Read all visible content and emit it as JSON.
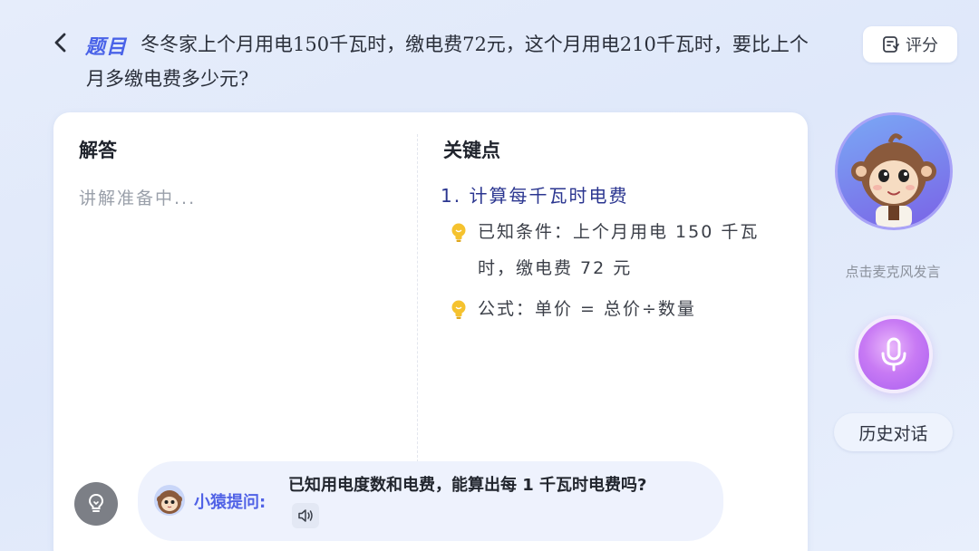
{
  "header": {
    "back_icon": "chevron-left-icon",
    "question_tag": "题目",
    "question_text": "冬冬家上个月用电150千瓦时，缴电费72元，这个月用电210千瓦时，要比上个月多缴电费多少元?",
    "rate_label": "评分",
    "rate_icon": "rating-icon"
  },
  "card": {
    "answer": {
      "title": "解答",
      "placeholder": "讲解准备中..."
    },
    "key_points": {
      "title": "关键点",
      "heading": "1. 计算每千瓦时电费",
      "items": [
        {
          "icon": "lightbulb-icon",
          "text": "已知条件：上个月用电 150 千瓦时，缴电费 72 元"
        },
        {
          "icon": "lightbulb-icon",
          "text": "公式：单价 = 总价÷数量"
        }
      ]
    },
    "ask": {
      "label": "小猿提问:",
      "text": "已知用电度数和电费，能算出每 1 千瓦时电费吗?",
      "sound_icon": "speaker-icon"
    }
  },
  "sidebar": {
    "mic_hint": "点击麦克风发言",
    "mic_icon": "microphone-icon",
    "history_label": "历史对话"
  },
  "colors": {
    "accent": "#4a63e8",
    "mic_purple": "#c87af4",
    "bulb_yellow": "#f5c22e",
    "key_heading": "#2b3690"
  }
}
